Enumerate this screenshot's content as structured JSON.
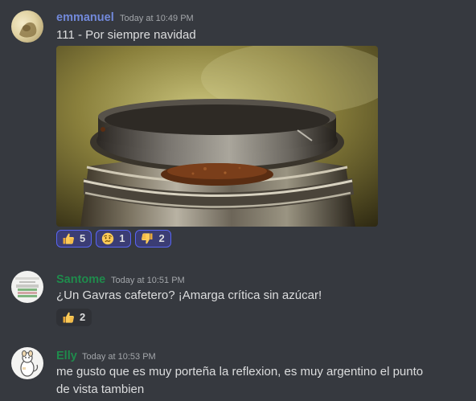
{
  "messages": [
    {
      "username": "emmanuel",
      "username_color": "#7289da",
      "timestamp": "Today at 10:49 PM",
      "text": "111 - Por siempre navidad",
      "reactions": [
        {
          "emoji": "thumbs-up",
          "count": "5"
        },
        {
          "emoji": "confused-face",
          "count": "1"
        },
        {
          "emoji": "thumbs-down",
          "count": "2"
        }
      ]
    },
    {
      "username": "Santome",
      "username_color": "#1f8b4c",
      "timestamp": "Today at 10:51 PM",
      "text": "¿Un Gavras cafetero? ¡Amarga crítica sin azúcar!",
      "reactions": [
        {
          "emoji": "thumbs-up",
          "count": "2"
        }
      ]
    },
    {
      "username": "Elly",
      "username_color": "#1f8b4c",
      "timestamp": "Today at 10:53 PM",
      "text_lines": [
        "me gusto que es muy porteña la reflexion, es muy argentino el punto",
        "de vista tambien"
      ]
    }
  ],
  "colors": {
    "background": "#36393f",
    "reaction_active_bg": "#3b3d74",
    "reaction_active_border": "#5865f2",
    "reaction_bg": "#2f3136",
    "text": "#dcddde",
    "timestamp": "#a3a6aa"
  }
}
